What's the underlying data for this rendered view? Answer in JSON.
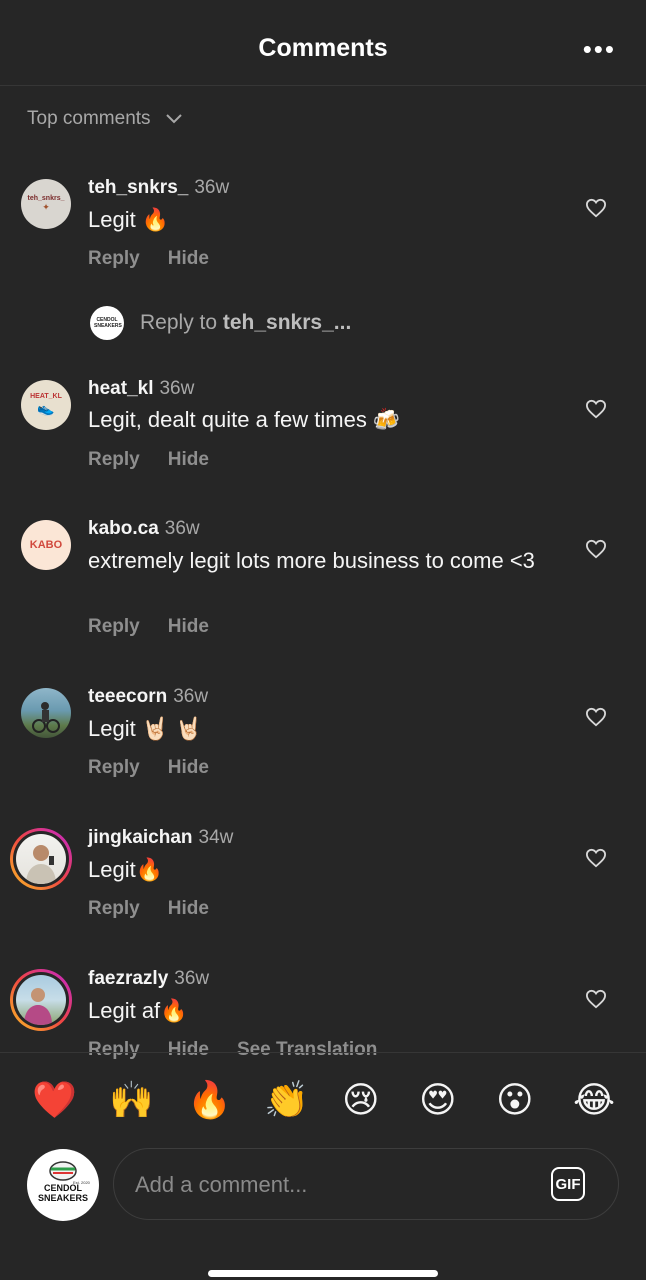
{
  "header": {
    "title": "Comments",
    "more_icon": "more-horizontal-icon"
  },
  "sort": {
    "label": "Top comments"
  },
  "actions": {
    "reply": "Reply",
    "hide": "Hide",
    "see_translation": "See Translation"
  },
  "comments": [
    {
      "username": "teh_snkrs_",
      "time": "36w",
      "text": "Legit 🔥",
      "avatar_text": "teh_snkrs_"
    },
    {
      "username": "heat_kl",
      "time": "36w",
      "text": "Legit, dealt quite a few times 🍻",
      "avatar_text": "HEAT_KL"
    },
    {
      "username": "kabo.ca",
      "time": "36w",
      "text": "extremely legit lots more business to come <3",
      "avatar_text": "KABO"
    },
    {
      "username": "teeecorn",
      "time": "36w",
      "text": "Legit 🤘🏻 🤘🏻"
    },
    {
      "username": "jingkaichan",
      "time": "34w",
      "text": "Legit🔥"
    },
    {
      "username": "faezrazly",
      "time": "36w",
      "text": "Legit af🔥"
    }
  ],
  "reply_thread": {
    "prefix": "Reply to ",
    "username": "teh_snkrs_...",
    "avatar_text": "CENDOL SNEAKERS"
  },
  "emoji_bar": [
    "❤️",
    "🙌",
    "🔥",
    "👏",
    "😢",
    "😍",
    "😮",
    "😂"
  ],
  "composer": {
    "placeholder": "Add a comment...",
    "gif_label": "GIF",
    "avatar_line1": "CENDOL",
    "avatar_line2": "SNEAKERS",
    "avatar_est": "Est. 2020"
  }
}
